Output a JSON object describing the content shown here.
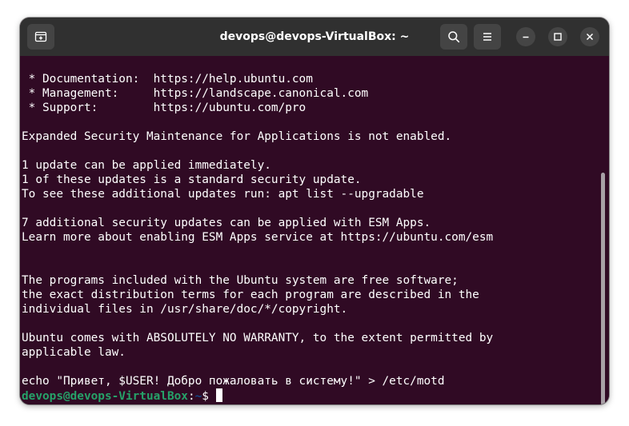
{
  "window": {
    "title": "devops@devops-VirtualBox: ~"
  },
  "toolbar": {
    "new_tab_icon": "new-tab-icon",
    "search_icon": "search-icon",
    "menu_icon": "hamburger-menu-icon",
    "minimize_icon": "minimize-icon",
    "maximize_icon": "maximize-icon",
    "close_icon": "close-icon"
  },
  "terminal": {
    "lines": [
      " * Documentation:  https://help.ubuntu.com",
      " * Management:     https://landscape.canonical.com",
      " * Support:        https://ubuntu.com/pro",
      "",
      "Expanded Security Maintenance for Applications is not enabled.",
      "",
      "1 update can be applied immediately.",
      "1 of these updates is a standard security update.",
      "To see these additional updates run: apt list --upgradable",
      "",
      "7 additional security updates can be applied with ESM Apps.",
      "Learn more about enabling ESM Apps service at https://ubuntu.com/esm",
      "",
      "",
      "The programs included with the Ubuntu system are free software;",
      "the exact distribution terms for each program are described in the",
      "individual files in /usr/share/doc/*/copyright.",
      "",
      "Ubuntu comes with ABSOLUTELY NO WARRANTY, to the extent permitted by",
      "applicable law.",
      "",
      "echo \"Привет, $USER! Добро пожаловать в систему!\" > /etc/motd"
    ],
    "prompt": {
      "user_host": "devops@devops-VirtualBox",
      "colon": ":",
      "path": "~",
      "symbol": "$"
    }
  },
  "colors": {
    "terminal_background": "#300a24",
    "titlebar_background": "#303030",
    "prompt_user": "#26a269",
    "prompt_path": "#12488b",
    "text": "#ffffff"
  }
}
